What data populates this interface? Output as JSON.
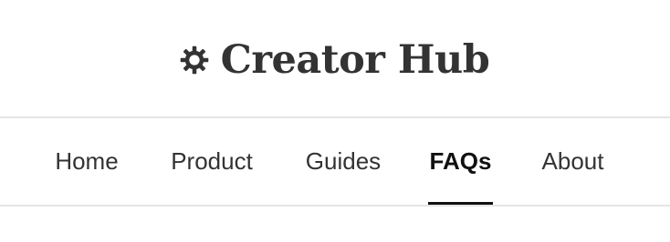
{
  "header": {
    "icon": "gear-icon",
    "title": "Creator Hub"
  },
  "nav": {
    "items": [
      {
        "label": "Home",
        "active": false
      },
      {
        "label": "Product",
        "active": false
      },
      {
        "label": "Guides",
        "active": false
      },
      {
        "label": "FAQs",
        "active": true
      },
      {
        "label": "About",
        "active": false
      }
    ]
  },
  "colors": {
    "text": "#333333",
    "active": "#111111",
    "divider": "#e4e4e4",
    "background": "#ffffff"
  }
}
